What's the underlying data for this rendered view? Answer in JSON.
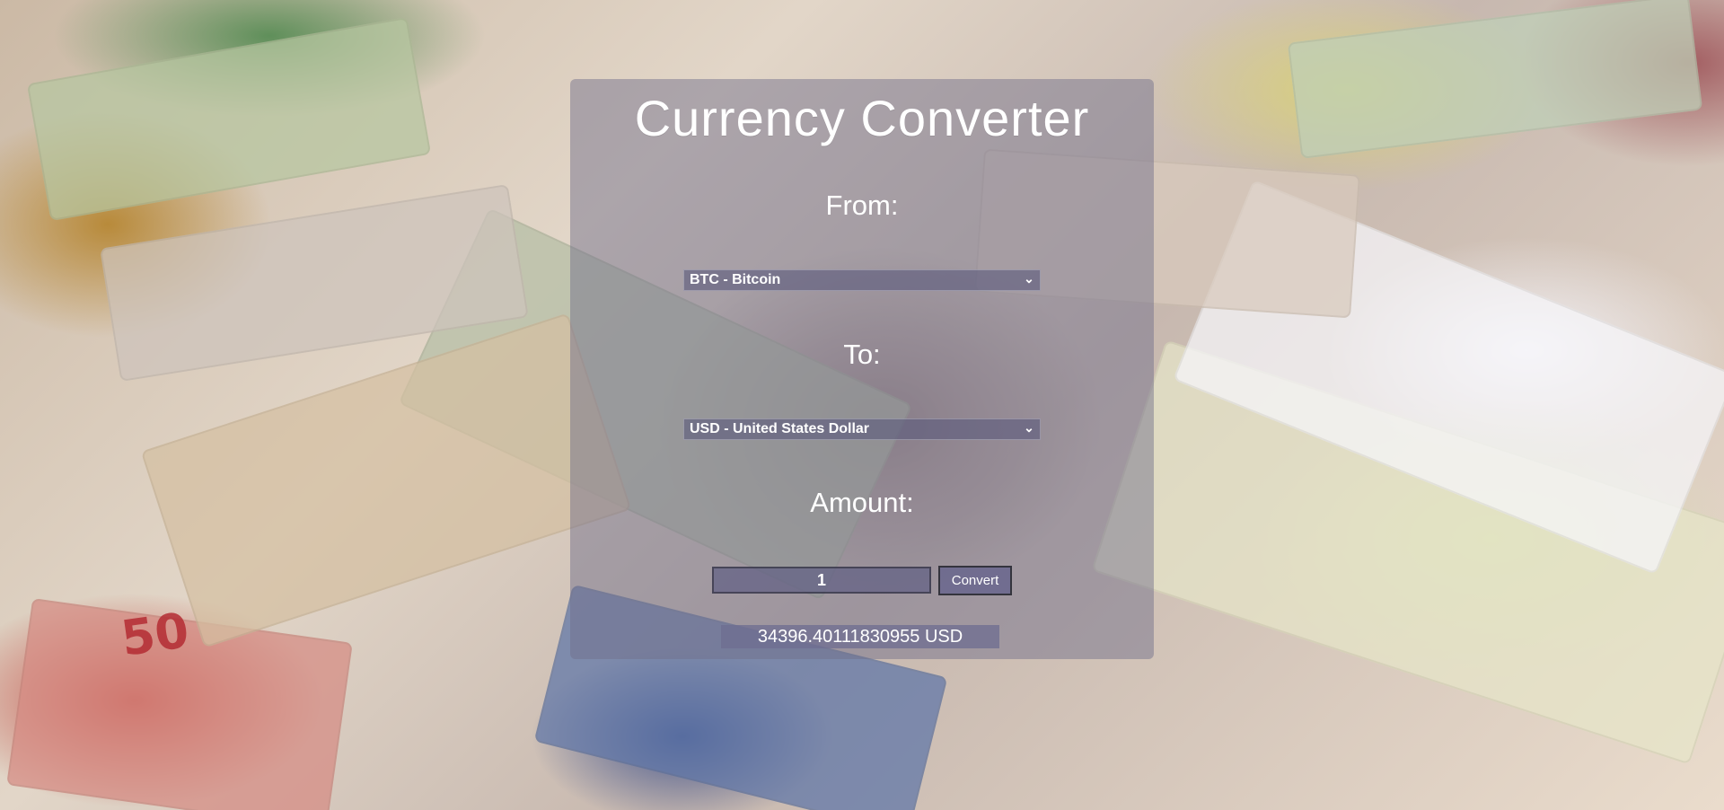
{
  "app": {
    "title": "Currency Converter"
  },
  "form": {
    "from_label": "From:",
    "to_label": "To:",
    "amount_label": "Amount:",
    "from_selected": "BTC - Bitcoin",
    "to_selected": "USD - United States Dollar",
    "amount_value": "1",
    "convert_label": "Convert"
  },
  "result": {
    "text": "34396.40111830955 USD"
  },
  "background_note": {
    "text": "50"
  },
  "icons": {
    "from_dropdown": "chevron-down-icon",
    "to_dropdown": "chevron-down-icon"
  }
}
